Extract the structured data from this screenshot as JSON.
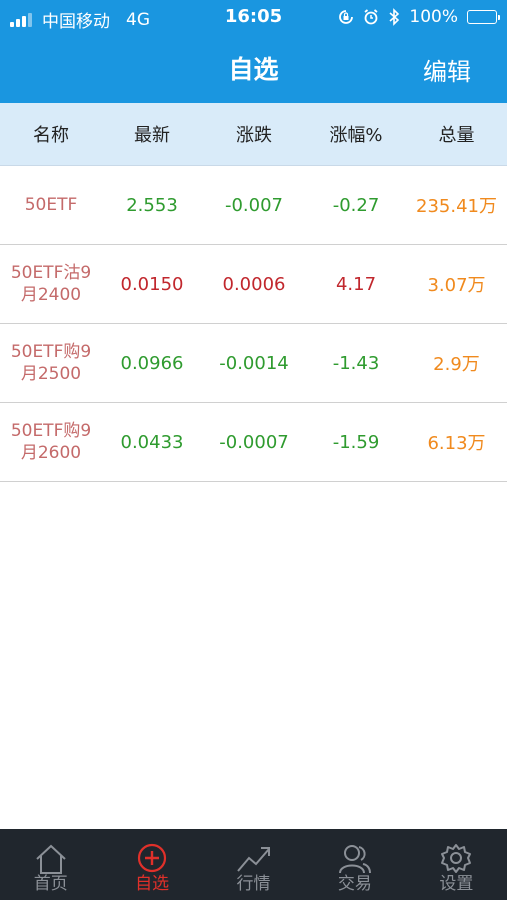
{
  "status_bar": {
    "carrier": "中国移动",
    "network": "4G",
    "time": "16:05",
    "battery": "100%"
  },
  "nav": {
    "title": "自选",
    "edit_label": "编辑"
  },
  "table": {
    "headers": [
      "名称",
      "最新",
      "涨跌",
      "涨幅%",
      "总量"
    ],
    "rows": [
      {
        "name": "50ETF",
        "latest": "2.553",
        "change": "-0.007",
        "pct": "-0.27",
        "volume": "235.41万"
      },
      {
        "name": "50ETF沽9月2400",
        "latest": "0.0150",
        "change": "0.0006",
        "pct": "4.17",
        "volume": "3.07万"
      },
      {
        "name": "50ETF购9月2500",
        "latest": "0.0966",
        "change": "-0.0014",
        "pct": "-1.43",
        "volume": "2.9万"
      },
      {
        "name": "50ETF购9月2600",
        "latest": "0.0433",
        "change": "-0.0007",
        "pct": "-1.59",
        "volume": "6.13万"
      }
    ]
  },
  "tabs": [
    {
      "label": "首页",
      "icon": "home-icon"
    },
    {
      "label": "自选",
      "icon": "add-circle-icon",
      "active": true
    },
    {
      "label": "行情",
      "icon": "trend-icon"
    },
    {
      "label": "交易",
      "icon": "users-icon"
    },
    {
      "label": "设置",
      "icon": "gear-icon"
    }
  ],
  "colors": {
    "header_blue": "#1a96e0",
    "table_header_bg": "#d9ebf9",
    "up_red": "#c1272d",
    "down_green": "#2f9b2f",
    "volume_orange": "#f08a1e",
    "tab_active": "#e0302a",
    "tabbar_bg": "#20262d"
  }
}
